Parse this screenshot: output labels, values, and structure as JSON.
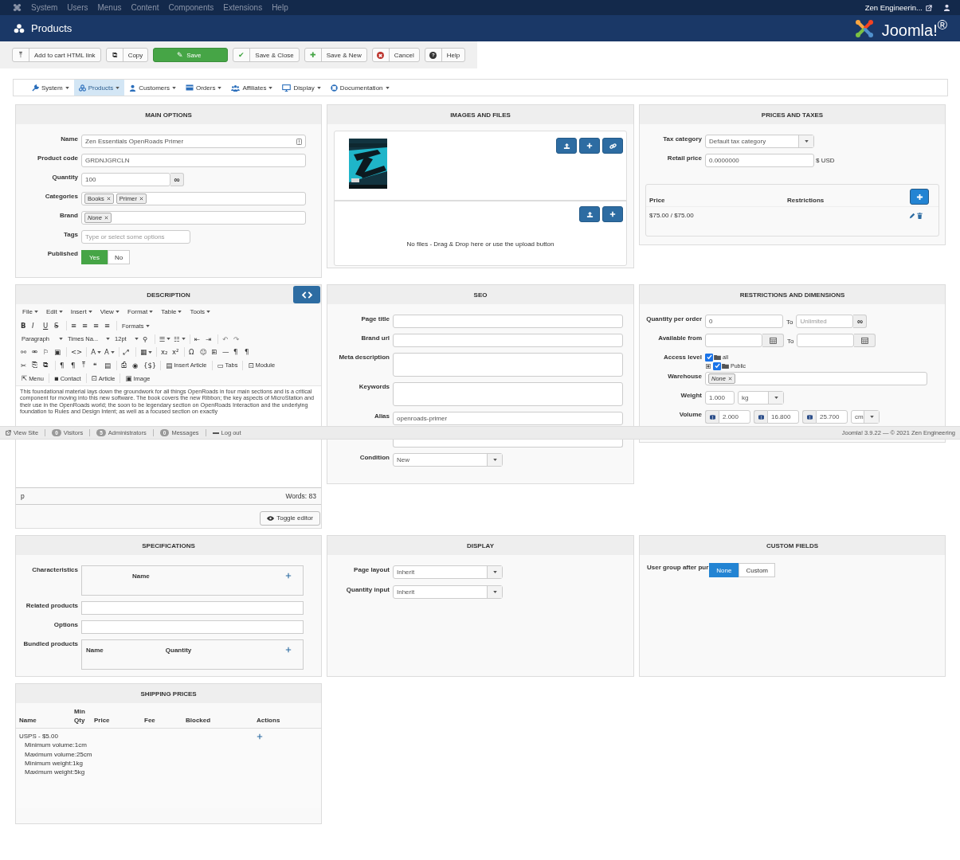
{
  "top_menu": {
    "items": [
      "System",
      "Users",
      "Menus",
      "Content",
      "Components",
      "Extensions",
      "Help"
    ],
    "user": "Zen Engineerin..."
  },
  "header": {
    "title": "Products",
    "logo": "Joomla!$^{®}$"
  },
  "toolbar": [
    {
      "icon": "⤒",
      "label": "Add to cart HTML link",
      "kind": "default"
    },
    {
      "icon": "⧉",
      "label": "Copy",
      "kind": "default"
    },
    {
      "icon": "✎",
      "label": "Save",
      "kind": "primary"
    },
    {
      "icon": "✔",
      "label": "Save & Close",
      "kind": "confirm"
    },
    {
      "icon": "✚",
      "label": "Save & New",
      "kind": "confirm"
    },
    {
      "icon": "✖",
      "label": "Cancel",
      "kind": "danger"
    },
    {
      "icon": "?",
      "label": "Help",
      "kind": "help"
    }
  ],
  "nav": [
    {
      "label": "System",
      "selected": false
    },
    {
      "label": "Products",
      "selected": true
    },
    {
      "label": "Customers",
      "selected": false
    },
    {
      "label": "Orders",
      "selected": false
    },
    {
      "label": "Affiliates",
      "selected": false
    },
    {
      "label": "Display",
      "selected": false
    },
    {
      "label": "Documentation",
      "selected": false
    }
  ],
  "main_options": {
    "title": "MAIN OPTIONS",
    "fields": [
      {
        "kind": "text",
        "label": "Name",
        "value": "Zen Essentials OpenRoads Primer",
        "info_icon": true
      },
      {
        "kind": "text",
        "label": "Product code",
        "value": "GRDNJGRCLN",
        "info_icon": false
      },
      {
        "kind": "counter",
        "label": "Quantity",
        "value": "100",
        "addon": "∞"
      },
      {
        "kind": "tags",
        "label": "Categories",
        "tags": [
          {
            "label": "Books",
            "italic": false
          },
          {
            "label": "Primer",
            "italic": false
          }
        ]
      },
      {
        "kind": "tags",
        "label": "Brand",
        "tags": [
          {
            "label": "None",
            "italic": true
          }
        ]
      },
      {
        "kind": "search",
        "label": "Tags",
        "placeholder": "Type or select some options"
      },
      {
        "kind": "toggle",
        "label": "Published",
        "options": [
          {
            "label": "Yes",
            "selected": true
          },
          {
            "label": "No",
            "selected": false
          }
        ]
      }
    ]
  },
  "images": {
    "title": "IMAGES AND FILES",
    "files_message": "No files - Drag & Drop here or use the upload button"
  },
  "prices": {
    "title": "PRICES AND TAXES",
    "tax_category": {
      "label": "Tax category",
      "value": "Default tax category"
    },
    "retail_price": {
      "label": "Retail price",
      "value": "0.0000000",
      "suffix": "$ USD"
    },
    "table": {
      "columns": [
        "Price",
        "Restrictions"
      ],
      "rows": [
        {
          "price": "$75.00 / $75.00"
        }
      ]
    }
  },
  "description": {
    "title": "DESCRIPTION",
    "menus": [
      "File",
      "Edit",
      "Insert",
      "View",
      "Format",
      "Table",
      "Tools"
    ],
    "tool_rows": [
      [
        {
          "kind": "bold",
          "icon": "B",
          "disabled": false
        },
        {
          "kind": "italic",
          "icon": "I",
          "disabled": false
        },
        {
          "kind": "underline",
          "icon": "U",
          "disabled": false
        },
        {
          "kind": "strike",
          "icon": "S",
          "disabled": false
        },
        {
          "kind": "separator"
        },
        {
          "kind": "tool",
          "icon": "≡",
          "disabled": false
        },
        {
          "kind": "tool",
          "icon": "≡",
          "disabled": false
        },
        {
          "kind": "tool",
          "icon": "≡",
          "disabled": false
        },
        {
          "kind": "tool",
          "icon": "≡",
          "disabled": false
        },
        {
          "kind": "separator"
        },
        {
          "kind": "menu",
          "label": "Formats"
        }
      ],
      [
        {
          "kind": "select",
          "label": "Paragraph"
        },
        {
          "kind": "select",
          "label": "Times Na..."
        },
        {
          "kind": "select",
          "label": "12pt"
        },
        {
          "kind": "tool",
          "icon": "⚲",
          "disabled": false
        },
        {
          "kind": "separator"
        },
        {
          "kind": "tool",
          "icon": "☰",
          "dropdown": true,
          "disabled": false
        },
        {
          "kind": "tool",
          "icon": "☷",
          "dropdown": true,
          "disabled": false
        },
        {
          "kind": "separator"
        },
        {
          "kind": "tool",
          "icon": "⇤",
          "disabled": false
        },
        {
          "kind": "tool",
          "icon": "⇥",
          "disabled": false
        },
        {
          "kind": "separator"
        },
        {
          "kind": "tool",
          "icon": "↶",
          "disabled": true
        },
        {
          "kind": "tool",
          "icon": "↷",
          "disabled": true
        }
      ],
      [
        {
          "kind": "tool",
          "icon": "⚯",
          "disabled": false
        },
        {
          "kind": "tool",
          "icon": "⚮",
          "disabled": false
        },
        {
          "kind": "tool",
          "icon": "⚐",
          "disabled": false
        },
        {
          "kind": "tool",
          "icon": "▣",
          "disabled": false
        },
        {
          "kind": "separator"
        },
        {
          "kind": "tool",
          "icon": "<>",
          "disabled": false
        },
        {
          "kind": "separator"
        },
        {
          "kind": "tool",
          "icon": "A",
          "dropdown": true,
          "disabled": false
        },
        {
          "kind": "tool",
          "icon": "A",
          "dropdown": true,
          "disabled": false
        },
        {
          "kind": "separator"
        },
        {
          "kind": "tool",
          "icon": "⤢",
          "disabled": false
        },
        {
          "kind": "separator"
        },
        {
          "kind": "tool",
          "icon": "▦",
          "dropdown": true,
          "disabled": false
        },
        {
          "kind": "separator"
        },
        {
          "kind": "tool",
          "icon": "x₂",
          "disabled": false
        },
        {
          "kind": "tool",
          "icon": "x²",
          "disabled": false
        },
        {
          "kind": "separator"
        },
        {
          "kind": "tool",
          "icon": "Ω",
          "disabled": false
        },
        {
          "kind": "tool",
          "icon": "☺",
          "disabled": false
        },
        {
          "kind": "tool",
          "icon": "⊞",
          "disabled": false
        },
        {
          "kind": "tool",
          "icon": "—",
          "disabled": false
        },
        {
          "kind": "tool",
          "icon": "¶",
          "disabled": false
        },
        {
          "kind": "tool",
          "icon": "¶",
          "disabled": false
        }
      ],
      [
        {
          "kind": "tool",
          "icon": "✂",
          "disabled": false
        },
        {
          "kind": "tool",
          "icon": "⎘",
          "disabled": false
        },
        {
          "kind": "tool",
          "icon": "⧉",
          "disabled": false
        },
        {
          "kind": "separator"
        },
        {
          "kind": "tool",
          "icon": "¶",
          "disabled": false
        },
        {
          "kind": "tool",
          "icon": "¶",
          "disabled": false
        },
        {
          "kind": "tool",
          "icon": "⤒",
          "disabled": false
        },
        {
          "kind": "tool",
          "icon": "❝",
          "disabled": false
        },
        {
          "kind": "tool",
          "icon": "▤",
          "disabled": false
        },
        {
          "kind": "separator"
        },
        {
          "kind": "tool",
          "icon": "⎙",
          "disabled": false
        },
        {
          "kind": "tool",
          "icon": "◉",
          "disabled": false
        },
        {
          "kind": "tool",
          "icon": "{$}",
          "disabled": false
        },
        {
          "kind": "separator"
        },
        {
          "kind": "button",
          "icon": "▤",
          "label": "Insert Article"
        },
        {
          "kind": "separator"
        },
        {
          "kind": "button",
          "icon": "▭",
          "label": "Tabs"
        },
        {
          "kind": "separator"
        },
        {
          "kind": "button",
          "icon": "⊡",
          "label": "Module"
        }
      ],
      [
        {
          "kind": "button",
          "icon": "⇱",
          "label": "Menu"
        },
        {
          "kind": "separator"
        },
        {
          "kind": "button",
          "icon": "▪",
          "label": "Contact"
        },
        {
          "kind": "separator"
        },
        {
          "kind": "button",
          "icon": "⊡",
          "label": "Article"
        },
        {
          "kind": "separator"
        },
        {
          "kind": "button",
          "icon": "▣",
          "label": "Image"
        }
      ]
    ],
    "text": "This foundational material lays down the groundwork for all things OpenRoads in four main sections and is a critical component for moving into this new software. The book covers the new Ribbon; the key aspects of MicroStation and their use in the OpenRoads world; the soon to be legendary section on OpenRoads Interaction and the underlying foundation to Rules and Design Intent; as well as a focused section on exactly",
    "path": "p",
    "words": "Words: 83",
    "toggle_editor": "Toggle editor"
  },
  "seo": {
    "title": "SEO",
    "fields": [
      {
        "kind": "empty",
        "label": "Page title"
      },
      {
        "kind": "empty",
        "label": "Brand url"
      },
      {
        "kind": "textarea",
        "label": "Meta description"
      },
      {
        "kind": "textarea",
        "label": "Keywords"
      },
      {
        "kind": "text",
        "label": "Alias",
        "value": "openroads-primer"
      },
      {
        "kind": "hidden-label"
      },
      {
        "kind": "select",
        "label": "Condition",
        "value": "New"
      }
    ]
  },
  "restrictions": {
    "title": "RESTRICTIONS AND DIMENSIONS",
    "quantity": {
      "label": "Quantity per order",
      "from": "0",
      "to_label": "To",
      "to_placeholder": "Unlimited",
      "addon": "∞"
    },
    "available": {
      "label": "Available from",
      "to_label": "To"
    },
    "access": {
      "label": "Access level",
      "tree": [
        {
          "label": "all",
          "checked": true,
          "children": [
            {
              "label": "Public",
              "checked": true,
              "expanded": false
            }
          ]
        }
      ]
    },
    "warehouse": {
      "label": "Warehouse",
      "tags": [
        {
          "label": "None",
          "italic": true
        }
      ]
    },
    "weight": {
      "label": "Weight",
      "value": "1.000",
      "unit": "kg"
    },
    "volume": {
      "label": "Volume",
      "values": [
        "2.000",
        "16.800",
        "25.700"
      ],
      "unit": "cm"
    }
  },
  "specifications": {
    "title": "SPECIFICATIONS",
    "characteristics": {
      "label": "Characteristics",
      "columns": [
        "Name"
      ]
    },
    "related": {
      "label": "Related products"
    },
    "options": {
      "label": "Options"
    },
    "bundled": {
      "label": "Bundled products",
      "columns": [
        "Name",
        "Quantity"
      ]
    }
  },
  "display": {
    "title": "DISPLAY",
    "fields": [
      {
        "label": "Page layout",
        "value": "Inherit"
      },
      {
        "label": "Quantity input",
        "value": "Inherit"
      }
    ]
  },
  "custom_fields": {
    "title": "CUSTOM FIELDS",
    "label": "User group after pur",
    "options": [
      {
        "label": "None",
        "selected": true
      },
      {
        "label": "Custom",
        "selected": false
      }
    ]
  },
  "shipping": {
    "title": "SHIPPING PRICES",
    "columns": [
      "Name",
      "Min Qty",
      "Price",
      "Fee",
      "Blocked",
      "Actions"
    ],
    "rows": [
      {
        "name": "USPS - $5.00",
        "details": [
          "Minimum volume:1cm",
          "Maximum volume:25cm",
          "Minimum weight:1kg",
          "Maximum weight:5kg"
        ]
      }
    ]
  },
  "status_bar": {
    "view_site": "View Site",
    "counters": [
      {
        "count": "0",
        "label": "Visitors"
      },
      {
        "count": "5",
        "label": "Administrators"
      },
      {
        "count": "0",
        "label": "Messages"
      }
    ],
    "logout": "Log out",
    "version": "Joomla! 3.9.22 — © 2021 Zen Engineering"
  }
}
